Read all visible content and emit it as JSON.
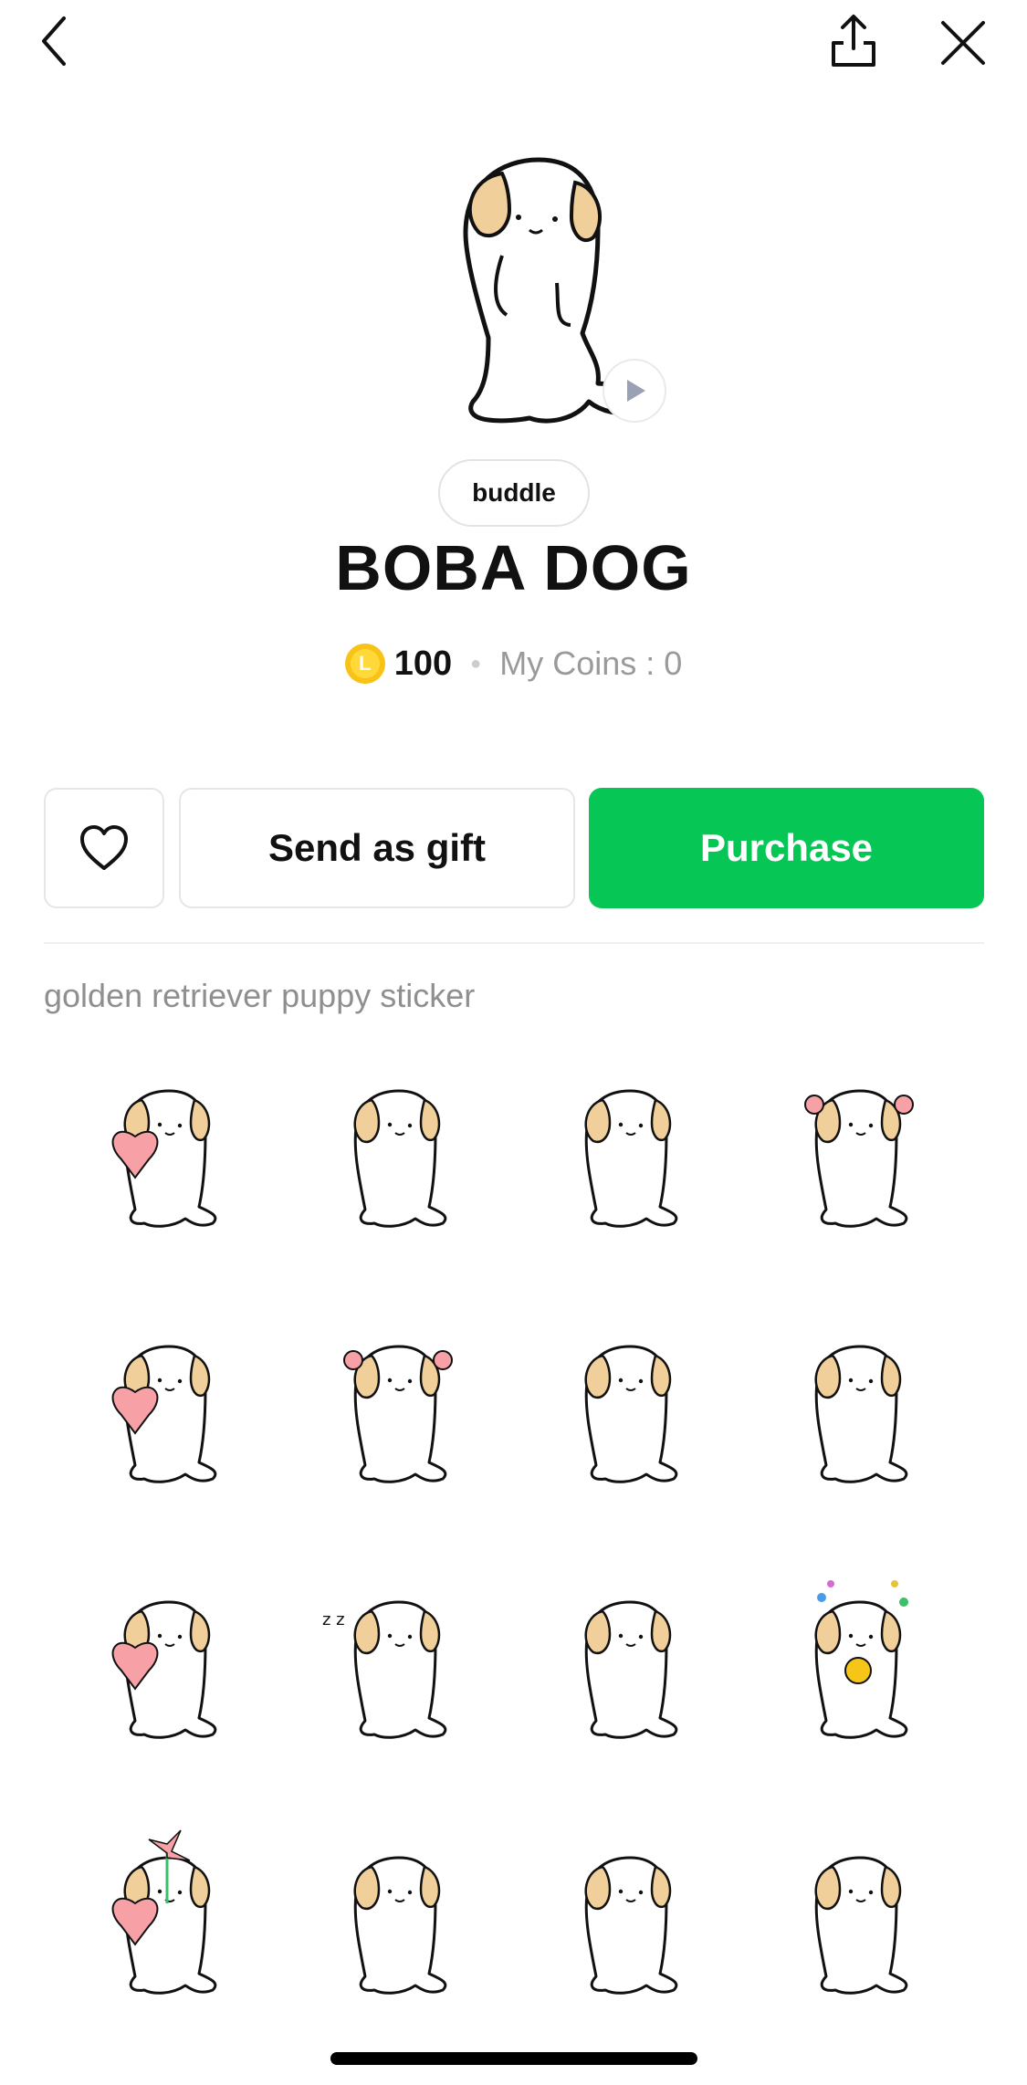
{
  "header": {
    "back_icon": "chevron-left-icon",
    "share_icon": "share-icon",
    "close_icon": "close-icon"
  },
  "product": {
    "author": "buddle",
    "title": "BOBA DOG",
    "price": "100",
    "coin_symbol": "L",
    "my_coins": "My Coins : 0",
    "description": "golden retriever puppy sticker"
  },
  "actions": {
    "favorite_icon": "heart-outline-icon",
    "gift_label": "Send as gift",
    "purchase_label": "Purchase"
  },
  "colors": {
    "accent_green": "#06c755",
    "coin_yellow": "#f7c316",
    "ear_tan": "#f0cf9a",
    "heart_pink": "#f7a0a6"
  },
  "stickers": [
    {
      "name": "dog-holding-heart"
    },
    {
      "name": "dog-back-view"
    },
    {
      "name": "dog-lying-stretch"
    },
    {
      "name": "dog-pink-pompoms"
    },
    {
      "name": "dog-waving"
    },
    {
      "name": "dog-flower-ears"
    },
    {
      "name": "dog-heart-hearts"
    },
    {
      "name": "dog-lying-side"
    },
    {
      "name": "dog-dizzy-thought"
    },
    {
      "name": "dog-sleeping-zzz"
    },
    {
      "name": "dog-annoyed"
    },
    {
      "name": "dog-party-hat"
    },
    {
      "name": "dog-pinwheel"
    },
    {
      "name": "dog-sparkles"
    },
    {
      "name": "dog-gloomy-wall"
    },
    {
      "name": "dog-standing"
    }
  ]
}
